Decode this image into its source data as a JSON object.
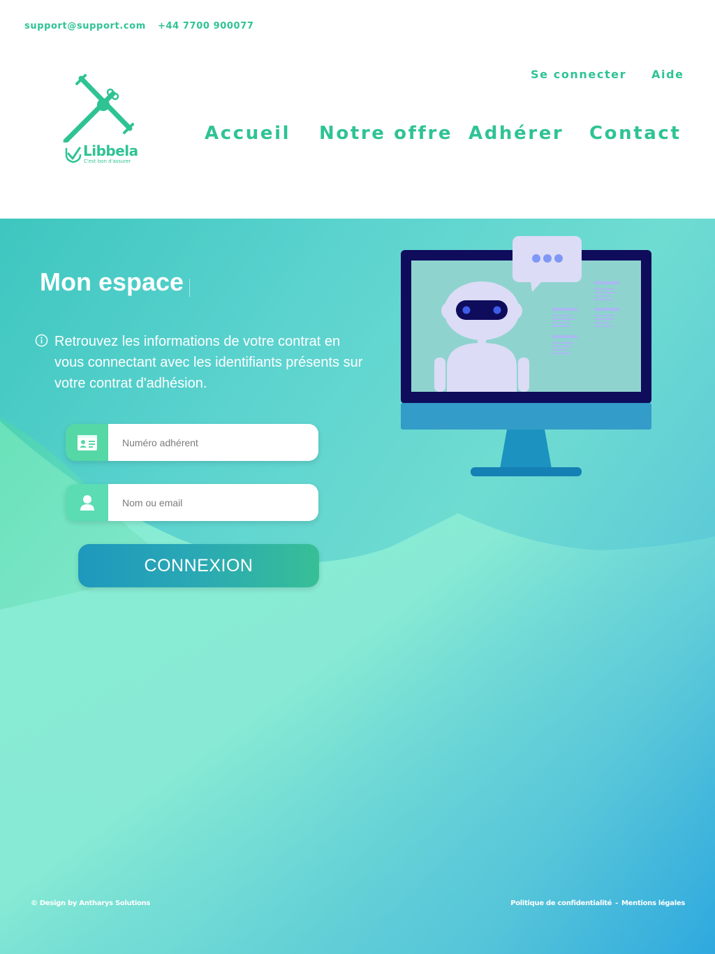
{
  "topbar": {
    "email": "support@support.com",
    "phone": "+44 7700 900077"
  },
  "utility_nav": {
    "login": "Se connecter",
    "help": "Aide"
  },
  "brand": {
    "name": "Libbela",
    "tagline": "C'est bon d'assurer"
  },
  "main_nav": [
    {
      "label": "Accueil"
    },
    {
      "label": "Notre offre"
    },
    {
      "label": "Adhérer"
    },
    {
      "label": "Contact"
    }
  ],
  "login": {
    "title": "Mon espace",
    "info_text": "Retrouvez les informations de votre contrat en vous connectant  avec les identifiants présents sur votre contrat d'adhésion.",
    "member_number": {
      "placeholder": "Numéro adhérent",
      "value": ""
    },
    "name_or_email": {
      "placeholder": "Nom ou email",
      "value": ""
    },
    "submit_label": "CONNEXION"
  },
  "footer": {
    "credit": "© Design by Antharys Solutions",
    "privacy": "Politique de confidentialité",
    "separator": "-",
    "legal": "Mentions légales"
  },
  "colors": {
    "brand_green": "#2fc394",
    "field_icon_green": "#55d7a6",
    "button_start": "#1e98bd",
    "button_end": "#37bf96",
    "monitor_frame": "#0f0c5c",
    "robot_body": "#dcdcf6"
  },
  "icons": {
    "info": "info-circle-icon",
    "member_card": "id-card-icon",
    "user": "user-icon",
    "chat": "chat-bubble-icon"
  }
}
